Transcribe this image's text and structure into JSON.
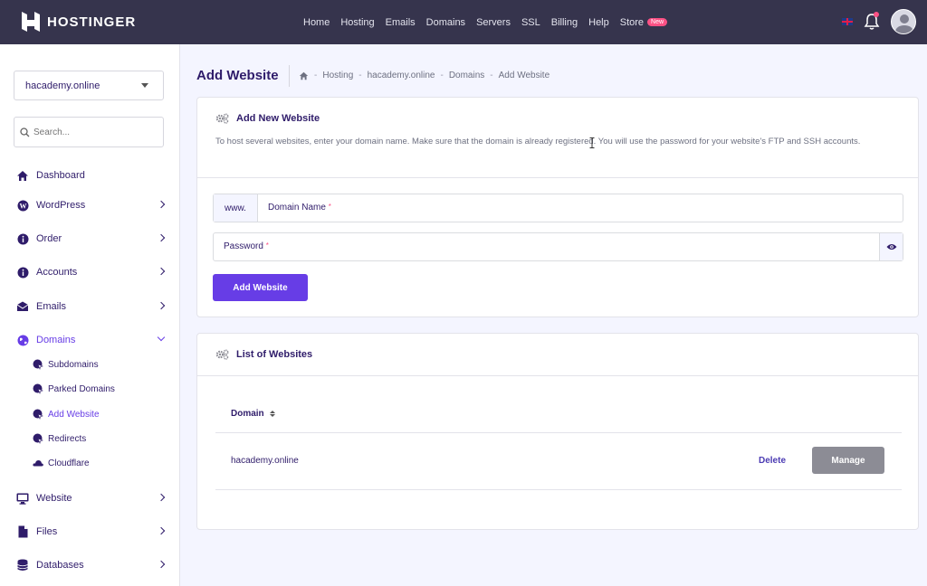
{
  "brand": {
    "name": "HOSTINGER"
  },
  "topnav": {
    "items": [
      "Home",
      "Hosting",
      "Emails",
      "Domains",
      "Servers",
      "SSL",
      "Billing",
      "Help",
      "Store"
    ],
    "store_badge": "New"
  },
  "sidebar": {
    "site_selector": "hacademy.online",
    "search_placeholder": "Search...",
    "items": [
      {
        "label": "Dashboard",
        "icon": "home-icon"
      },
      {
        "label": "WordPress",
        "icon": "wordpress-icon"
      },
      {
        "label": "Order",
        "icon": "info-icon"
      },
      {
        "label": "Accounts",
        "icon": "info-icon"
      },
      {
        "label": "Emails",
        "icon": "envelope-icon"
      },
      {
        "label": "Domains",
        "icon": "globe-icon"
      },
      {
        "label": "Website",
        "icon": "monitor-icon"
      },
      {
        "label": "Files",
        "icon": "file-icon"
      },
      {
        "label": "Databases",
        "icon": "database-icon"
      }
    ],
    "domains_sub": [
      "Subdomains",
      "Parked Domains",
      "Add Website",
      "Redirects",
      "Cloudflare"
    ]
  },
  "page": {
    "title": "Add Website",
    "breadcrumb": [
      "Hosting",
      "hacademy.online",
      "Domains",
      "Add Website"
    ]
  },
  "add_card": {
    "title": "Add New Website",
    "description": "To host several websites, enter your domain name. Make sure that the domain is already registered. You will use the password for your website's FTP and SSH accounts.",
    "www_prefix": "www.",
    "domain_label": "Domain Name",
    "password_label": "Password",
    "required_mark": "*",
    "submit_label": "Add Website"
  },
  "list_card": {
    "title": "List of Websites",
    "column_domain": "Domain",
    "rows": [
      {
        "domain": "hacademy.online",
        "delete_label": "Delete",
        "manage_label": "Manage"
      }
    ]
  },
  "colors": {
    "primary": "#673de6",
    "topbar": "#36344d",
    "text": "#2f1c6a",
    "badge": "#fc5185"
  }
}
